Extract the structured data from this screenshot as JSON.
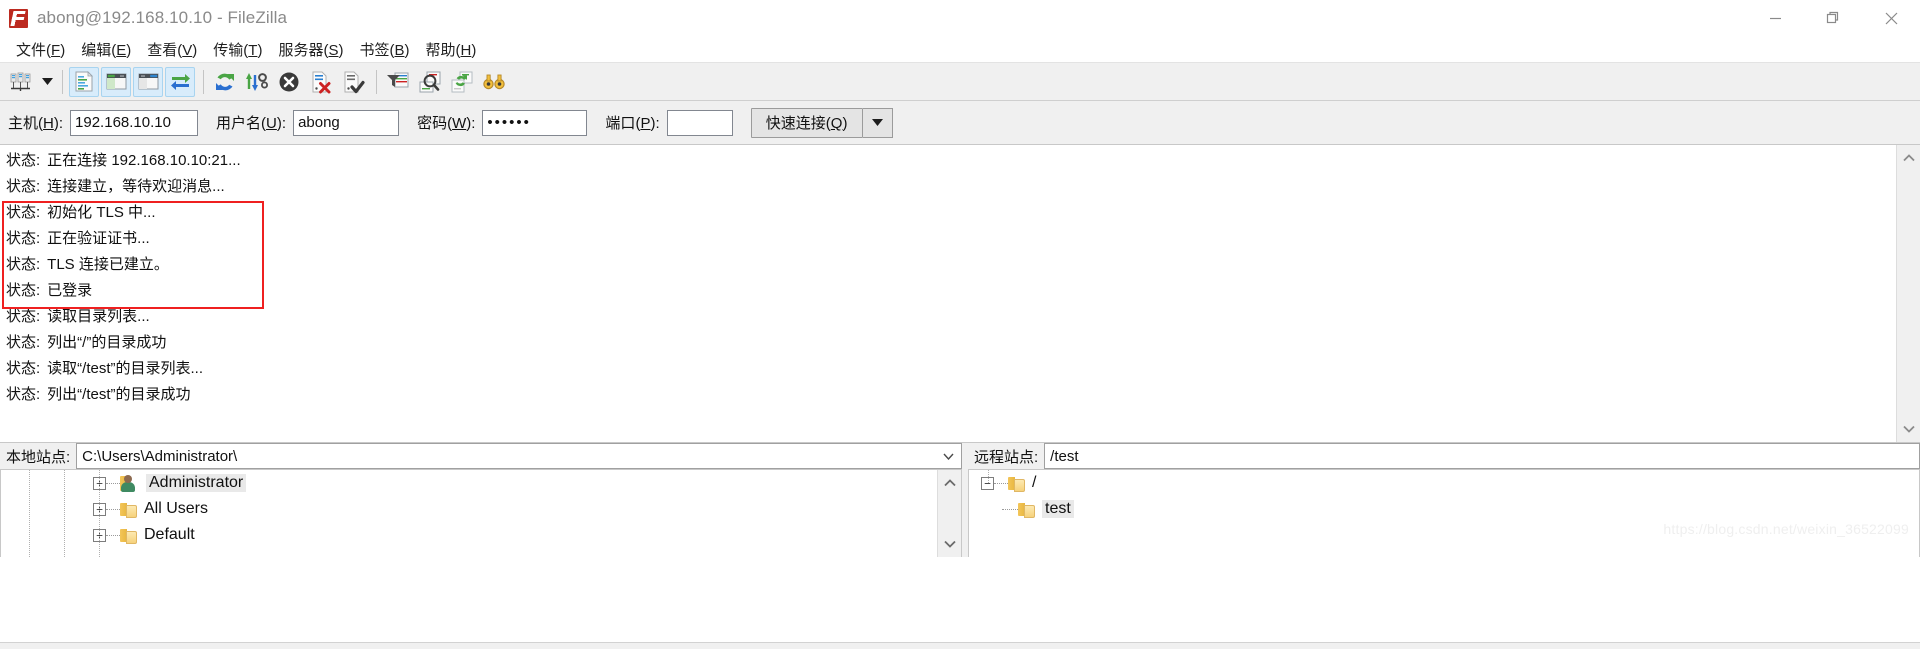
{
  "window": {
    "title": "abong@192.168.10.10 - FileZilla",
    "logo_icon": "filezilla-logo-icon",
    "minimize_icon": "minimize-icon",
    "maximize_icon": "maximize-restore-icon",
    "close_icon": "close-icon"
  },
  "menubar": {
    "items": [
      {
        "label": "文件",
        "mnemonic": "F"
      },
      {
        "label": "编辑",
        "mnemonic": "E"
      },
      {
        "label": "查看",
        "mnemonic": "V"
      },
      {
        "label": "传输",
        "mnemonic": "T"
      },
      {
        "label": "服务器",
        "mnemonic": "S"
      },
      {
        "label": "书签",
        "mnemonic": "B"
      },
      {
        "label": "帮助",
        "mnemonic": "H"
      }
    ]
  },
  "toolbar": {
    "buttons": [
      {
        "name": "site-manager-icon",
        "pressed": false
      },
      {
        "name": "site-manager-dropdown-caret-icon",
        "pressed": false
      },
      {
        "name": "toggle-message-log-icon",
        "pressed": true
      },
      {
        "name": "toggle-local-tree-icon",
        "pressed": true
      },
      {
        "name": "toggle-remote-tree-icon",
        "pressed": true
      },
      {
        "name": "toggle-transfer-queue-icon",
        "pressed": true
      },
      {
        "name": "refresh-icon",
        "pressed": false
      },
      {
        "name": "process-queue-icon",
        "pressed": false
      },
      {
        "name": "cancel-operation-icon",
        "pressed": false
      },
      {
        "name": "disconnect-icon",
        "pressed": false
      },
      {
        "name": "reconnect-icon",
        "pressed": false
      },
      {
        "name": "filter-icon",
        "pressed": false
      },
      {
        "name": "compare-directories-icon",
        "pressed": false
      },
      {
        "name": "synchronized-browsing-icon",
        "pressed": false
      },
      {
        "name": "search-remote-files-icon",
        "pressed": false
      }
    ]
  },
  "quickconnect": {
    "host": {
      "label": "主机",
      "mnemonic": "H",
      "value": "192.168.10.10",
      "placeholder": ""
    },
    "user": {
      "label": "用户名",
      "mnemonic": "U",
      "value": "abong",
      "placeholder": ""
    },
    "password": {
      "label": "密码",
      "mnemonic": "W",
      "value": "••••••",
      "placeholder": ""
    },
    "port": {
      "label": "端口",
      "mnemonic": "P",
      "value": "",
      "placeholder": ""
    },
    "connect_button": {
      "label": "快速连接",
      "mnemonic": "Q"
    },
    "dropdown_icon": "chevron-down-icon"
  },
  "log": {
    "prefix": "状态:",
    "lines": [
      "正在连接 192.168.10.10:21...",
      "连接建立，等待欢迎消息...",
      "初始化 TLS 中...",
      "正在验证证书...",
      "TLS 连接已建立。",
      "已登录",
      "读取目录列表...",
      "列出“/”的目录成功",
      "读取“/test”的目录列表...",
      "列出“/test”的目录成功"
    ],
    "highlight": {
      "color": "#ef2020",
      "first_line_index": 2,
      "last_line_index": 5
    },
    "scrollbar": {
      "up_icon": "chevron-up-icon",
      "down_icon": "chevron-down-icon"
    }
  },
  "local_site": {
    "label": "本地站点:",
    "path": "C:\\Users\\Administrator\\",
    "path_dropdown_icon": "chevron-down-icon",
    "tree": [
      {
        "label": "Administrator",
        "icon": "user-folder-icon",
        "expander": "+",
        "selected": true,
        "indent": 0
      },
      {
        "label": "All Users",
        "icon": "folder-icon",
        "expander": "+",
        "selected": false,
        "indent": 0
      },
      {
        "label": "Default",
        "icon": "folder-icon",
        "expander": "+",
        "selected": false,
        "indent": 0
      }
    ],
    "scrollbar": {
      "up_icon": "chevron-up-icon",
      "down_icon": "chevron-down-icon"
    }
  },
  "remote_site": {
    "label": "远程站点:",
    "path": "/test",
    "tree": [
      {
        "label": "/",
        "icon": "folder-icon",
        "expander": "−",
        "selected": false,
        "indent": 0
      },
      {
        "label": "test",
        "icon": "folder-icon",
        "expander": "",
        "selected": true,
        "indent": 1
      }
    ]
  },
  "watermark": {
    "text": "https://blog.csdn.net/weixin_36522099"
  }
}
